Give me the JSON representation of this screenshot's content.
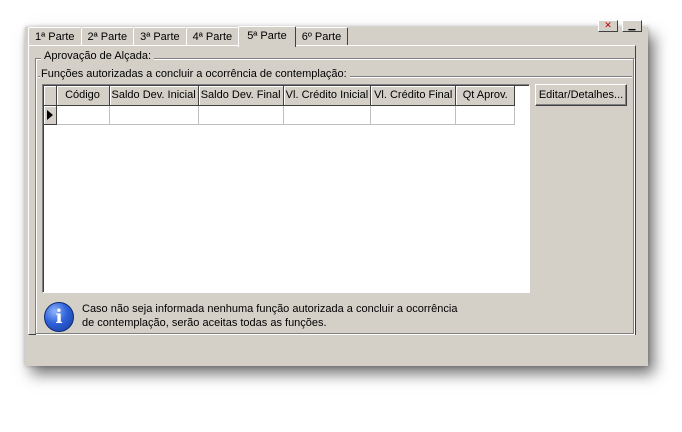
{
  "window": {
    "corner_buttons": [
      {
        "icon": "close-icon",
        "glyph": "✕"
      },
      {
        "icon": "minimize-icon",
        "glyph": "▁"
      }
    ]
  },
  "tabs": [
    {
      "label": "1ª Parte",
      "active": false
    },
    {
      "label": "2ª Parte",
      "active": false
    },
    {
      "label": "3ª Parte",
      "active": false
    },
    {
      "label": "4ª Parte",
      "active": false
    },
    {
      "label": "5ª Parte",
      "active": true
    },
    {
      "label": "6º Parte",
      "active": false
    }
  ],
  "group": {
    "title": "Aprovação de Alçada:",
    "subtitle": "Funções autorizadas a concluir a ocorrência de contemplação:"
  },
  "grid": {
    "columns": [
      "Código",
      "Saldo Dev. Inicial",
      "Saldo Dev. Final",
      "Vl. Crédito Inicial",
      "Vl. Crédito Final",
      "Qt Aprov."
    ],
    "rows": [
      [
        "",
        "",
        "",
        "",
        "",
        ""
      ]
    ]
  },
  "edit_button": {
    "label": "Editar/Detalhes..."
  },
  "info": {
    "icon": "info-icon",
    "line1": "Caso não seja informada nenhuma função autorizada a concluir a ocorrência",
    "line2": "de contemplação, serão aceitas todas as funções."
  }
}
